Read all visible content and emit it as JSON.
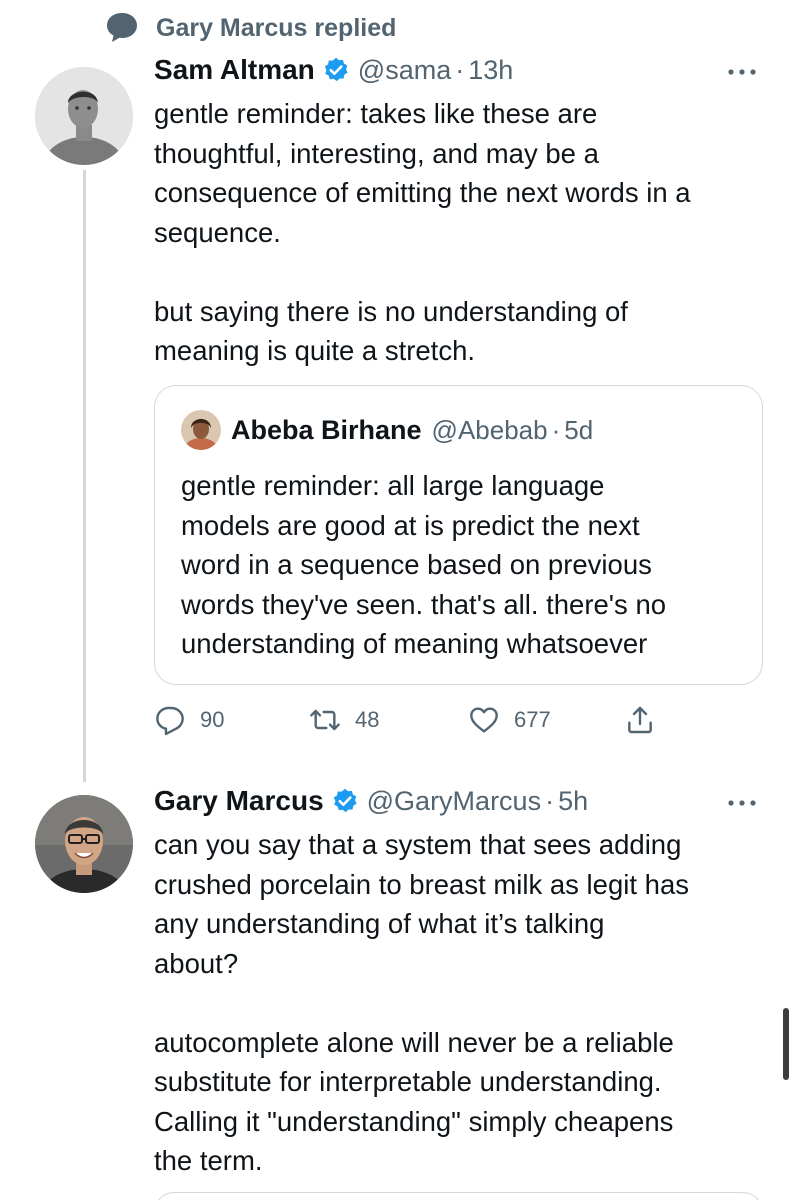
{
  "context": {
    "icon": "speech-bubble-icon",
    "text": "Gary Marcus replied"
  },
  "colors": {
    "verified_blue": "#1d9bf0",
    "secondary_text": "#536471",
    "primary_text": "#0f1419",
    "border": "#cfd9de"
  },
  "tweet1": {
    "display_name": "Sam Altman",
    "handle": "@sama",
    "separator": "·",
    "time": "13h",
    "text": "gentle reminder: takes like these are\nthoughtful, interesting, and may be a\nconsequence of emitting the next words in a\nsequence.\n\nbut saying there is no understanding of\nmeaning is quite a stretch.",
    "quote": {
      "display_name": "Abeba Birhane",
      "handle": "@Abebab",
      "separator": "·",
      "time": "5d",
      "text": "gentle reminder: all large language\nmodels are good at is predict the next\nword in a sequence based on previous\nwords they've seen. that's all. there's no\nunderstanding of meaning whatsoever"
    },
    "actions": {
      "replies": "90",
      "retweets": "48",
      "likes": "677"
    }
  },
  "tweet2": {
    "display_name": "Gary Marcus",
    "handle": "@GaryMarcus",
    "separator": "·",
    "time": "5h",
    "text": "can you say that a system that sees adding\ncrushed porcelain to breast milk as legit has\nany understanding of what it’s talking\nabout?\n\nautocomplete alone will never be a reliable\nsubstitute for interpretable understanding.\nCalling it \"understanding\" simply cheapens\nthe term."
  }
}
